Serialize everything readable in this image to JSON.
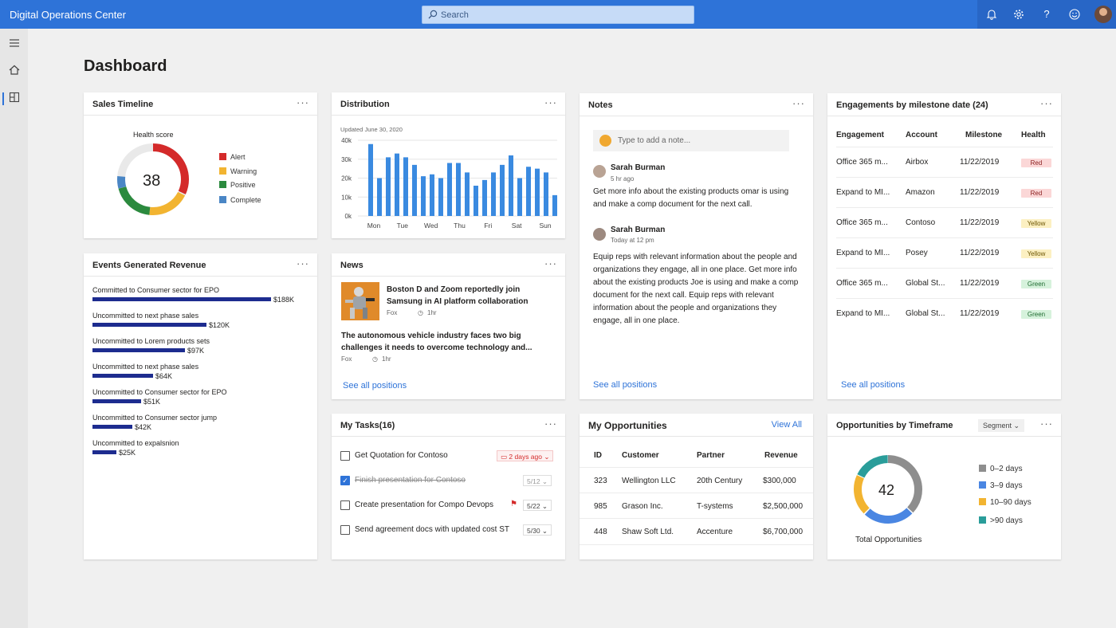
{
  "app": {
    "title": "Digital Operations Center"
  },
  "search": {
    "placeholder": "Search",
    "icon": "search-icon"
  },
  "topbar_icons": [
    "bell-icon",
    "gear-icon",
    "help-icon",
    "smiley-icon"
  ],
  "sidenav": {
    "items": [
      "hamburger-icon",
      "home-icon",
      "dashboard-icon"
    ]
  },
  "page": {
    "title": "Dashboard"
  },
  "colors": {
    "accent": "#2e73d8",
    "alert": "#d42a2a",
    "warning": "#f2b431",
    "positive": "#2b8a3e",
    "complete": "#4a86c5",
    "bar_dark": "#1d2c8f"
  },
  "sales_timeline": {
    "title": "Sales Timeline",
    "chart_label": "Health score",
    "score": "38",
    "legend": [
      "Alert",
      "Warning",
      "Positive",
      "Complete"
    ]
  },
  "distribution": {
    "title": "Distribution",
    "updated": "Updated June 30, 2020",
    "yticks": [
      "40k",
      "30k",
      "20k",
      "10k",
      "0k"
    ],
    "xticks": [
      "Mon",
      "Tue",
      "Wed",
      "Thu",
      "Fri",
      "Sat",
      "Sun"
    ]
  },
  "chart_data": {
    "type": "bar",
    "xlabel": "",
    "ylabel": "",
    "ylim": [
      0,
      40000
    ],
    "grid": true,
    "values": [
      38000,
      20000,
      31000,
      33000,
      31000,
      27000,
      21000,
      22000,
      20000,
      28000,
      28000,
      23000,
      16000,
      19000,
      23000,
      27000,
      32000,
      20000,
      26000,
      25000,
      23000,
      11000
    ]
  },
  "notes": {
    "title": "Notes",
    "placeholder": "Type to add a note...",
    "items": [
      {
        "author": "Sarah Burman",
        "time": "5 hr ago",
        "text": "Get more info about the existing products omar is using and make a comp document for the next call."
      },
      {
        "author": "Sarah Burman",
        "time": "Today at 12 pm",
        "text": "Equip reps with relevant information about the people and organizations they engage, all in one place. Get more info about the existing products Joe is using and make a comp document for the next call. Equip reps with relevant information about the people and organizations they engage, all in one place."
      }
    ],
    "link": "See all positions"
  },
  "engagements": {
    "title": "Engagements by milestone date (24)",
    "columns": [
      "Engagement",
      "Account",
      "Milestone",
      "Health"
    ],
    "rows": [
      {
        "engagement": "Office 365 m...",
        "account": "Airbox",
        "milestone": "11/22/2019",
        "health": "Red"
      },
      {
        "engagement": "Expand to MI...",
        "account": "Amazon",
        "milestone": "11/22/2019",
        "health": "Red"
      },
      {
        "engagement": "Office 365 m...",
        "account": "Contoso",
        "milestone": "11/22/2019",
        "health": "Yellow"
      },
      {
        "engagement": "Expand to MI...",
        "account": "Posey",
        "milestone": "11/22/2019",
        "health": "Yellow"
      },
      {
        "engagement": "Office 365 m...",
        "account": "Global St...",
        "milestone": "11/22/2019",
        "health": "Green"
      },
      {
        "engagement": "Expand to MI...",
        "account": "Global St...",
        "milestone": "11/22/2019",
        "health": "Green"
      }
    ],
    "link": "See all positions"
  },
  "events_revenue": {
    "title": "Events Generated Revenue",
    "items": [
      {
        "label": "Committed to Consumer sector for EPO",
        "value": "$188K",
        "amount": 188
      },
      {
        "label": "Uncommitted to next phase sales",
        "value": "$120K",
        "amount": 120
      },
      {
        "label": "Uncommitted to Lorem products sets",
        "value": "$97K",
        "amount": 97
      },
      {
        "label": "Uncommitted to next phase sales",
        "value": "$64K",
        "amount": 64
      },
      {
        "label": "Uncommitted to Consumer sector for EPO",
        "value": "$51K",
        "amount": 51
      },
      {
        "label": "Uncommitted to Consumer sector jump",
        "value": "$42K",
        "amount": 42
      },
      {
        "label": "Uncommitted to expalsnion",
        "value": "$25K",
        "amount": 25
      }
    ]
  },
  "news": {
    "title": "News",
    "items": [
      {
        "headline": "Boston D and Zoom reportedly join Samsung in AI platform collaboration",
        "source": "Fox",
        "time": "1hr"
      },
      {
        "headline": "The autonomous vehicle industry faces two big challenges it needs to overcome technology and...",
        "source": "Fox",
        "time": "1hr"
      }
    ],
    "link": "See all positions"
  },
  "tasks": {
    "title": "My Tasks(16)",
    "items": [
      {
        "label": "Get Quotation for Contoso",
        "date": "2 days ago",
        "done": false,
        "overdue": true
      },
      {
        "label": "Finish presentation for Contoso",
        "date": "5/12",
        "done": true,
        "overdue": false
      },
      {
        "label": "Create presentation for Compo Devops",
        "date": "5/22",
        "done": false,
        "flag": true
      },
      {
        "label": "Send agreement docs with updated cost ST",
        "date": "5/30",
        "done": false
      }
    ]
  },
  "opportunities": {
    "title": "My Opportunities",
    "view_all": "View All",
    "columns": [
      "ID",
      "Customer",
      "Partner",
      "Revenue"
    ],
    "rows": [
      {
        "id": "323",
        "customer": "Wellington  LLC",
        "partner": "20th Century",
        "revenue": "$300,000"
      },
      {
        "id": "985",
        "customer": "Grason Inc.",
        "partner": "T-systems",
        "revenue": "$2,500,000"
      },
      {
        "id": "448",
        "customer": "Shaw Soft Ltd.",
        "partner": "Accenture",
        "revenue": "$6,700,000"
      }
    ]
  },
  "timeframe": {
    "title": "Opportunities by Timeframe",
    "segment": "Segment",
    "total": "42",
    "total_label": "Total Opportunities",
    "legend": [
      "0–2 days",
      "3–9 days",
      "10–90 days",
      ">90 days"
    ]
  }
}
